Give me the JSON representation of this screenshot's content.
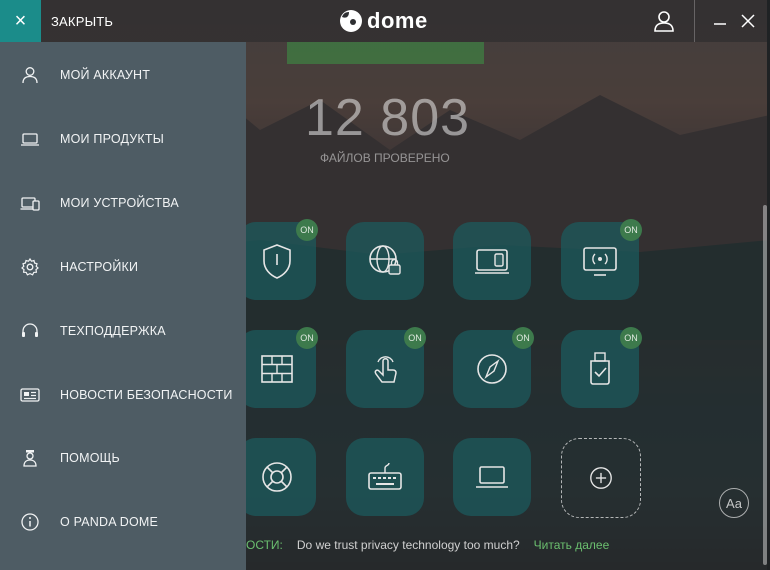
{
  "titlebar": {
    "close_label": "ЗАКРЫТЬ",
    "close_icon": "×",
    "logo_text": "dome",
    "min_icon": "–",
    "x_icon": "×"
  },
  "stats": {
    "files_count": "12 803",
    "files_label": "ФАЙЛОВ ПРОВЕРЕНО"
  },
  "menu": {
    "items": [
      {
        "label": "МОЙ АККАУНТ",
        "icon": "user-icon"
      },
      {
        "label": "МОИ ПРОДУКТЫ",
        "icon": "laptop-icon"
      },
      {
        "label": "МОИ УСТРОЙСТВА",
        "icon": "devices-icon"
      },
      {
        "label": "НАСТРОЙКИ",
        "icon": "gear-icon"
      },
      {
        "label": "ТЕХПОДДЕРЖКА",
        "icon": "headset-icon"
      },
      {
        "label": "НОВОСТИ БЕЗОПАСНОСТИ",
        "icon": "news-icon"
      },
      {
        "label": "ПОМОЩЬ",
        "icon": "help-person-icon"
      },
      {
        "label": "О PANDA DOME",
        "icon": "info-icon"
      }
    ]
  },
  "tiles": {
    "on_label": "ON",
    "items": [
      {
        "icon": "shield-icon",
        "on": true
      },
      {
        "icon": "web-lock-icon",
        "on": false
      },
      {
        "icon": "device-control-icon",
        "on": false
      },
      {
        "icon": "wifi-monitor-icon",
        "on": true
      },
      {
        "icon": "firewall-icon",
        "on": true
      },
      {
        "icon": "touch-icon",
        "on": true
      },
      {
        "icon": "compass-icon",
        "on": true
      },
      {
        "icon": "usb-icon",
        "on": true
      },
      {
        "icon": "lifebuoy-icon",
        "on": false
      },
      {
        "icon": "keyboard-icon",
        "on": false
      },
      {
        "icon": "laptop-icon",
        "on": false
      },
      {
        "icon": "add-icon",
        "on": false
      }
    ]
  },
  "news": {
    "prefix": "ОСТИ:",
    "text": "Do we trust privacy technology too much?",
    "link": "Читать далее"
  },
  "font_button": "Aa",
  "colors": {
    "accent": "#1b8c8a",
    "sidebar": "#4e5c64",
    "badge_green": "#3d7a4c",
    "link_green": "#6bbf6f"
  }
}
